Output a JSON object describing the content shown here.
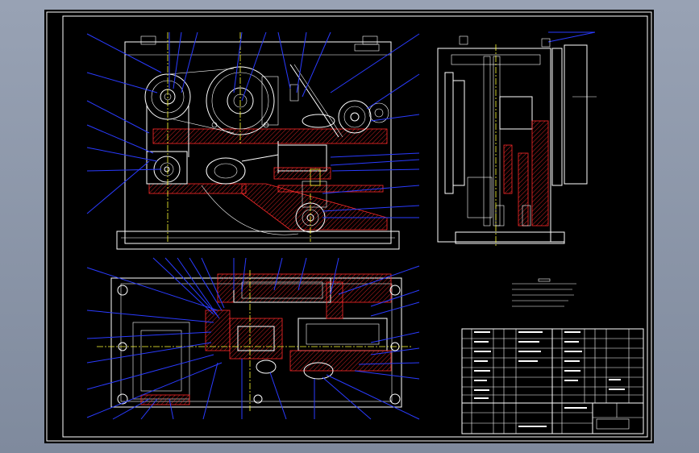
{
  "drawing": {
    "background": "#000000",
    "frame_color": "#ffffff",
    "section_color": "#ff2a2a",
    "leader_color": "#2a3bff",
    "centerline_color": "#ffff33"
  },
  "icons": [
    "pulley-icon",
    "gear-icon",
    "bolt-hole-icon",
    "motor-icon"
  ]
}
